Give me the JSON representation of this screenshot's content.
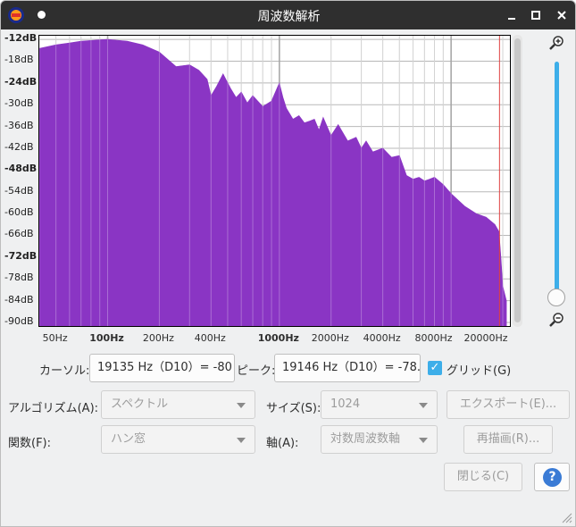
{
  "window": {
    "title": "周波数解析"
  },
  "plot": {
    "y_labels": [
      "-12dB",
      "-18dB",
      "-24dB",
      "-30dB",
      "-36dB",
      "-42dB",
      "-48dB",
      "-54dB",
      "-60dB",
      "-66dB",
      "-72dB",
      "-78dB",
      "-84dB",
      "-90dB"
    ],
    "x_labels": [
      "50Hz",
      "100Hz",
      "200Hz",
      "400Hz",
      "1000Hz",
      "2000Hz",
      "4000Hz",
      "8000Hz",
      "20000Hz"
    ],
    "fill_color": "#8a35c4",
    "cursor_color": "#e04040"
  },
  "chart_data": {
    "type": "area",
    "xlabel": "",
    "ylabel": "",
    "x_scale": "log",
    "xlim": [
      40,
      22000
    ],
    "ylim": [
      -91,
      -11
    ],
    "grid": true,
    "x_ticks": [
      50,
      100,
      200,
      400,
      1000,
      2000,
      4000,
      8000,
      20000
    ],
    "y_ticks": [
      -12,
      -18,
      -24,
      -30,
      -36,
      -42,
      -48,
      -54,
      -60,
      -66,
      -72,
      -78,
      -84,
      -90
    ],
    "series": [
      {
        "x": [
          40,
          50,
          60,
          70,
          80,
          90,
          100,
          130,
          160,
          200,
          250,
          300,
          340,
          380,
          400,
          430,
          470,
          520,
          560,
          600,
          650,
          700,
          800,
          900,
          1000,
          1050,
          1100,
          1200,
          1300,
          1400,
          1500,
          1600,
          1700,
          1800,
          2000,
          2200,
          2500,
          2800,
          3000,
          3200,
          3500,
          4000,
          4500,
          5000,
          5500,
          6000,
          6500,
          7000,
          7500,
          8000,
          9000,
          10000,
          12000,
          14000,
          16000,
          18000,
          19000,
          19500,
          20000,
          21000
        ],
        "values": [
          -14.5,
          -13.5,
          -13,
          -12.5,
          -12.3,
          -12.1,
          -12,
          -12.5,
          -13.5,
          -15.5,
          -19.5,
          -19,
          -20.5,
          -23,
          -27.5,
          -25,
          -21.5,
          -25.5,
          -28,
          -26.5,
          -29.5,
          -27.5,
          -30.5,
          -29,
          -24,
          -28,
          -31,
          -34,
          -33,
          -35,
          -34.5,
          -34,
          -37,
          -33.5,
          -38.5,
          -35.5,
          -40,
          -39,
          -42,
          -40,
          -43,
          -42,
          -44.5,
          -44,
          -49.5,
          -50.5,
          -50,
          -51,
          -50.5,
          -50,
          -52,
          -54.5,
          -58,
          -60,
          -61,
          -63,
          -65,
          -72,
          -80,
          -84
        ]
      }
    ]
  },
  "controls": {
    "cursor_label": "カーソル:",
    "cursor_value": "19135 Hz（D10）= -80",
    "peak_label": "ピーク:",
    "peak_value": "19146 Hz（D10）= -78.",
    "grid_label": "グリッド(G)",
    "grid_checked": true,
    "algorithm_label": "アルゴリズム(A):",
    "algorithm_value": "スペクトル",
    "size_label": "サイズ(S):",
    "size_value": "1024",
    "export_label": "エクスポート(E)...",
    "function_label": "関数(F):",
    "function_value": "ハン窓",
    "axis_label": "軸(A):",
    "axis_value": "対数周波数軸",
    "replot_label": "再描画(R)...",
    "close_label": "閉じる(C)",
    "help_label": "?"
  }
}
